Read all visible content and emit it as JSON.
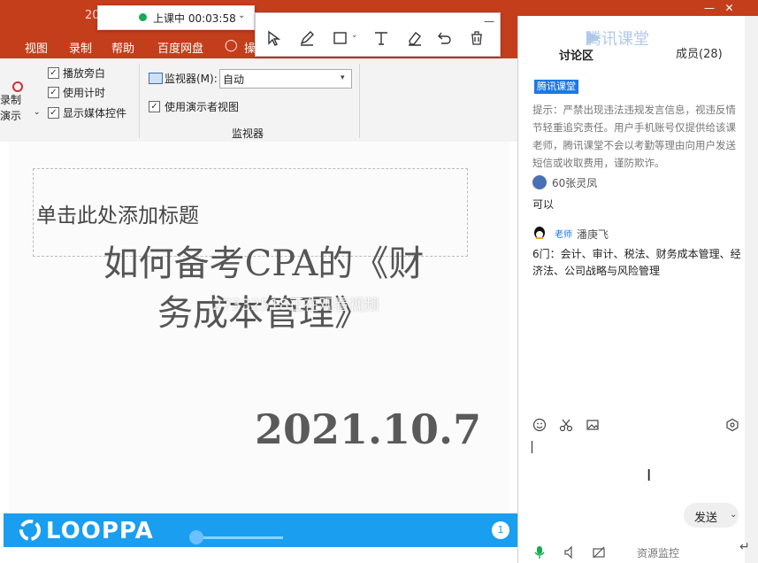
{
  "powerpoint": {
    "title_partial": "20",
    "tabs": [
      "视图",
      "录制",
      "帮助",
      "百度网盘",
      "操"
    ],
    "ribbon": {
      "left_cut": [
        "录制",
        "演示"
      ],
      "checks": [
        "播放旁白",
        "使用计时",
        "显示媒体控件"
      ],
      "monitor_label": "监视器(M):",
      "monitor_value": "自动",
      "presenter_view": "使用演示者视图",
      "group_label": "监视器"
    }
  },
  "live_bar": {
    "status": "上课中 00:03:58"
  },
  "slide": {
    "placeholder": "单击此处添加标题",
    "title_line1": "如何备考CPA的《财",
    "title_line2": "务成本管理》",
    "watermark": "27332518正在观看视频",
    "date": "2021.10.7"
  },
  "player": {
    "logo": "LOOPPA",
    "page": "1"
  },
  "chat": {
    "brand": "腾讯课堂",
    "tab_discuss": "讨论区",
    "tab_members": "成员(28)",
    "tag": "腾讯课堂",
    "notice": "提示：严禁出现违法违规发言信息，视违反情节轻重追究责任。用户手机账号仅提供给该课老师，腾讯课堂不会以考勤等理由向用户发送短信或收取费用，谨防欺诈。",
    "messages": [
      {
        "user": "60张灵凤",
        "text": "可以"
      },
      {
        "user": "潘庚飞",
        "badge": "老师",
        "text": "6门：会计、审计、税法、财务成本管理、经济法、公司战略与风险管理"
      }
    ],
    "send": "发送",
    "status": "资源监控"
  },
  "colors": {
    "ppt_red": "#c43e1c",
    "player_blue": "#1a9ef0",
    "tag_blue": "#1e78e6"
  }
}
